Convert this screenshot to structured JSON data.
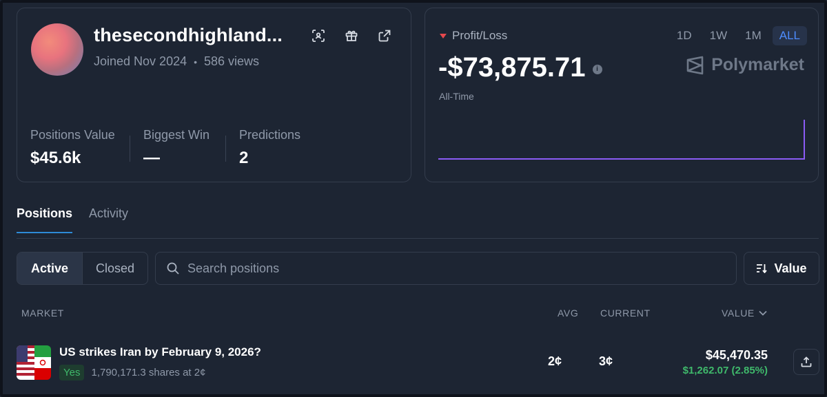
{
  "profile": {
    "username": "thesecondhighland...",
    "joined": "Joined Nov 2024",
    "views": "586 views",
    "icons": [
      "scan-icon",
      "gift-icon",
      "external-link-icon"
    ],
    "stats": [
      {
        "label": "Positions Value",
        "value": "$45.6k"
      },
      {
        "label": "Biggest Win",
        "value": "—"
      },
      {
        "label": "Predictions",
        "value": "2"
      }
    ]
  },
  "pnl": {
    "label": "Profit/Loss",
    "value": "-$73,875.71",
    "period_label": "All-Time",
    "ranges": [
      "1D",
      "1W",
      "1M",
      "ALL"
    ],
    "active_range": "ALL",
    "brand": "Polymarket",
    "line_color": "#8b5cf6"
  },
  "tabs": [
    "Positions",
    "Activity"
  ],
  "filters": {
    "segments": [
      "Active",
      "Closed"
    ],
    "search_placeholder": "Search positions",
    "sort_label": "Value"
  },
  "table": {
    "headers": {
      "market": "MARKET",
      "avg": "AVG",
      "current": "CURRENT",
      "value": "VALUE"
    },
    "rows": [
      {
        "title": "US strikes Iran by February 9, 2026?",
        "outcome": "Yes",
        "shares": "1,790,171.3 shares at 2¢",
        "avg": "2¢",
        "current": "3¢",
        "value": "$45,470.35",
        "change": "$1,262.07 (2.85%)"
      }
    ]
  },
  "colors": {
    "background": "#1d2533",
    "accent": "#4e8dff",
    "positive": "#3fb96b",
    "negative": "#e5484d"
  }
}
